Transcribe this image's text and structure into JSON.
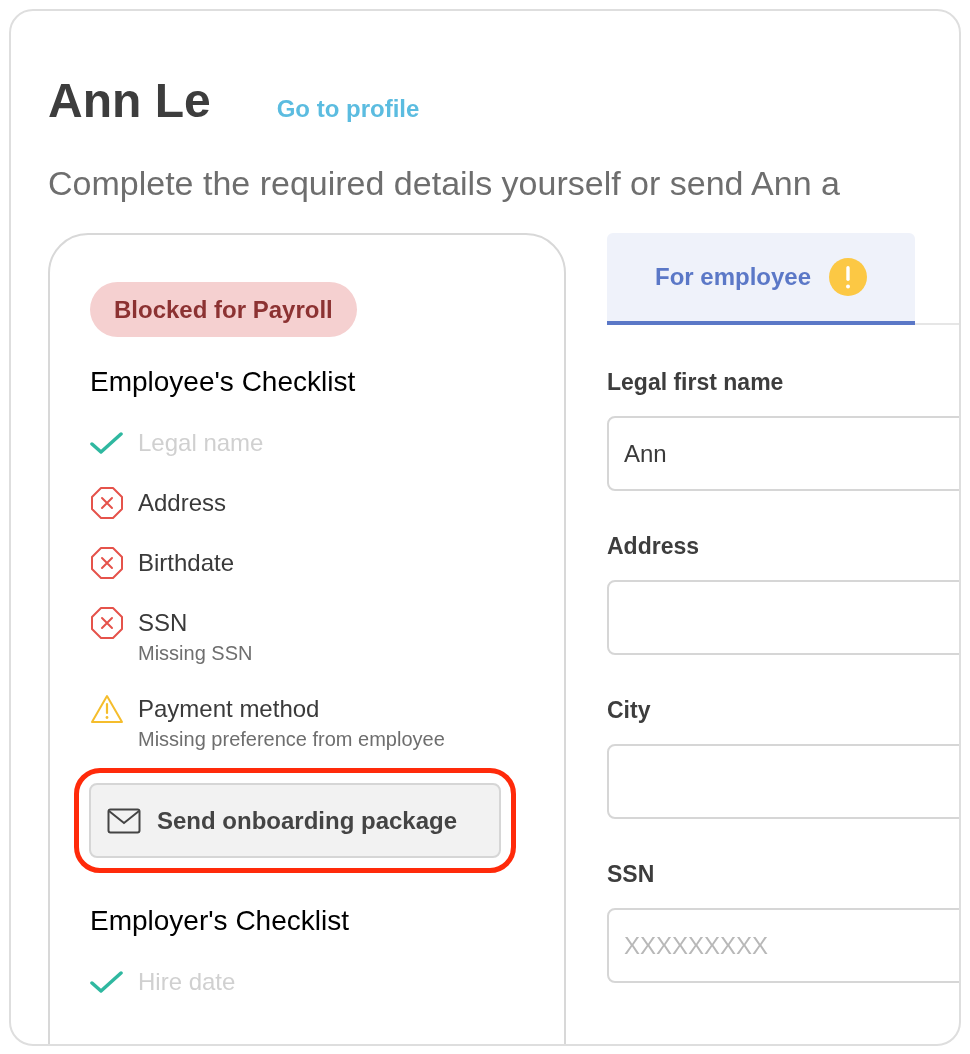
{
  "header": {
    "name": "Ann Le",
    "profile_link": "Go to profile",
    "subtitle": "Complete the required details yourself or send Ann a"
  },
  "status_badge": "Blocked for Payroll",
  "checklists": [
    {
      "title": "Employee's Checklist",
      "items": [
        {
          "label": "Legal name",
          "kind": "done"
        },
        {
          "label": "Address",
          "kind": "error"
        },
        {
          "label": "Birthdate",
          "kind": "error"
        },
        {
          "label": "SSN",
          "kind": "error",
          "note": "Missing SSN"
        },
        {
          "label": "Payment method",
          "kind": "warning",
          "note": "Missing preference from employee"
        }
      ],
      "action": {
        "label": "Send onboarding package",
        "highlighted": true
      }
    },
    {
      "title": "Employer's Checklist",
      "items": [
        {
          "label": "Hire date",
          "kind": "done"
        }
      ]
    }
  ],
  "tabs": [
    {
      "label": "For employee",
      "selected": true,
      "warning": true
    }
  ],
  "fields": [
    {
      "label": "Legal first name",
      "value": "Ann"
    },
    {
      "label": "Address"
    },
    {
      "label": "City"
    },
    {
      "label": "SSN",
      "placeholder": "XXXXXXXXX"
    }
  ]
}
